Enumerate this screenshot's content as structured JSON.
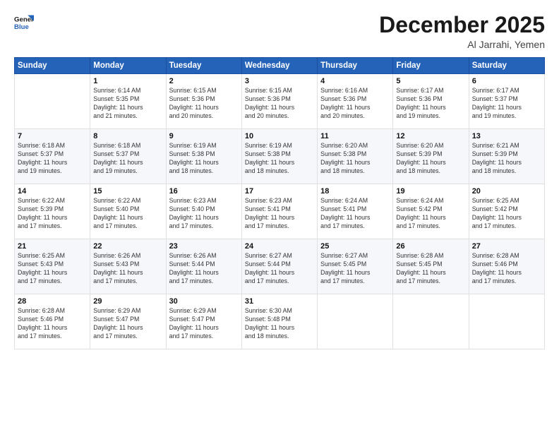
{
  "logo": {
    "line1": "General",
    "line2": "Blue"
  },
  "title": "December 2025",
  "subtitle": "Al Jarrahi, Yemen",
  "days_header": [
    "Sunday",
    "Monday",
    "Tuesday",
    "Wednesday",
    "Thursday",
    "Friday",
    "Saturday"
  ],
  "weeks": [
    [
      {
        "day": "",
        "info": ""
      },
      {
        "day": "1",
        "info": "Sunrise: 6:14 AM\nSunset: 5:35 PM\nDaylight: 11 hours\nand 21 minutes."
      },
      {
        "day": "2",
        "info": "Sunrise: 6:15 AM\nSunset: 5:36 PM\nDaylight: 11 hours\nand 20 minutes."
      },
      {
        "day": "3",
        "info": "Sunrise: 6:15 AM\nSunset: 5:36 PM\nDaylight: 11 hours\nand 20 minutes."
      },
      {
        "day": "4",
        "info": "Sunrise: 6:16 AM\nSunset: 5:36 PM\nDaylight: 11 hours\nand 20 minutes."
      },
      {
        "day": "5",
        "info": "Sunrise: 6:17 AM\nSunset: 5:36 PM\nDaylight: 11 hours\nand 19 minutes."
      },
      {
        "day": "6",
        "info": "Sunrise: 6:17 AM\nSunset: 5:37 PM\nDaylight: 11 hours\nand 19 minutes."
      }
    ],
    [
      {
        "day": "7",
        "info": "Sunrise: 6:18 AM\nSunset: 5:37 PM\nDaylight: 11 hours\nand 19 minutes."
      },
      {
        "day": "8",
        "info": "Sunrise: 6:18 AM\nSunset: 5:37 PM\nDaylight: 11 hours\nand 19 minutes."
      },
      {
        "day": "9",
        "info": "Sunrise: 6:19 AM\nSunset: 5:38 PM\nDaylight: 11 hours\nand 18 minutes."
      },
      {
        "day": "10",
        "info": "Sunrise: 6:19 AM\nSunset: 5:38 PM\nDaylight: 11 hours\nand 18 minutes."
      },
      {
        "day": "11",
        "info": "Sunrise: 6:20 AM\nSunset: 5:38 PM\nDaylight: 11 hours\nand 18 minutes."
      },
      {
        "day": "12",
        "info": "Sunrise: 6:20 AM\nSunset: 5:39 PM\nDaylight: 11 hours\nand 18 minutes."
      },
      {
        "day": "13",
        "info": "Sunrise: 6:21 AM\nSunset: 5:39 PM\nDaylight: 11 hours\nand 18 minutes."
      }
    ],
    [
      {
        "day": "14",
        "info": "Sunrise: 6:22 AM\nSunset: 5:39 PM\nDaylight: 11 hours\nand 17 minutes."
      },
      {
        "day": "15",
        "info": "Sunrise: 6:22 AM\nSunset: 5:40 PM\nDaylight: 11 hours\nand 17 minutes."
      },
      {
        "day": "16",
        "info": "Sunrise: 6:23 AM\nSunset: 5:40 PM\nDaylight: 11 hours\nand 17 minutes."
      },
      {
        "day": "17",
        "info": "Sunrise: 6:23 AM\nSunset: 5:41 PM\nDaylight: 11 hours\nand 17 minutes."
      },
      {
        "day": "18",
        "info": "Sunrise: 6:24 AM\nSunset: 5:41 PM\nDaylight: 11 hours\nand 17 minutes."
      },
      {
        "day": "19",
        "info": "Sunrise: 6:24 AM\nSunset: 5:42 PM\nDaylight: 11 hours\nand 17 minutes."
      },
      {
        "day": "20",
        "info": "Sunrise: 6:25 AM\nSunset: 5:42 PM\nDaylight: 11 hours\nand 17 minutes."
      }
    ],
    [
      {
        "day": "21",
        "info": "Sunrise: 6:25 AM\nSunset: 5:43 PM\nDaylight: 11 hours\nand 17 minutes."
      },
      {
        "day": "22",
        "info": "Sunrise: 6:26 AM\nSunset: 5:43 PM\nDaylight: 11 hours\nand 17 minutes."
      },
      {
        "day": "23",
        "info": "Sunrise: 6:26 AM\nSunset: 5:44 PM\nDaylight: 11 hours\nand 17 minutes."
      },
      {
        "day": "24",
        "info": "Sunrise: 6:27 AM\nSunset: 5:44 PM\nDaylight: 11 hours\nand 17 minutes."
      },
      {
        "day": "25",
        "info": "Sunrise: 6:27 AM\nSunset: 5:45 PM\nDaylight: 11 hours\nand 17 minutes."
      },
      {
        "day": "26",
        "info": "Sunrise: 6:28 AM\nSunset: 5:45 PM\nDaylight: 11 hours\nand 17 minutes."
      },
      {
        "day": "27",
        "info": "Sunrise: 6:28 AM\nSunset: 5:46 PM\nDaylight: 11 hours\nand 17 minutes."
      }
    ],
    [
      {
        "day": "28",
        "info": "Sunrise: 6:28 AM\nSunset: 5:46 PM\nDaylight: 11 hours\nand 17 minutes."
      },
      {
        "day": "29",
        "info": "Sunrise: 6:29 AM\nSunset: 5:47 PM\nDaylight: 11 hours\nand 17 minutes."
      },
      {
        "day": "30",
        "info": "Sunrise: 6:29 AM\nSunset: 5:47 PM\nDaylight: 11 hours\nand 17 minutes."
      },
      {
        "day": "31",
        "info": "Sunrise: 6:30 AM\nSunset: 5:48 PM\nDaylight: 11 hours\nand 18 minutes."
      },
      {
        "day": "",
        "info": ""
      },
      {
        "day": "",
        "info": ""
      },
      {
        "day": "",
        "info": ""
      }
    ]
  ]
}
